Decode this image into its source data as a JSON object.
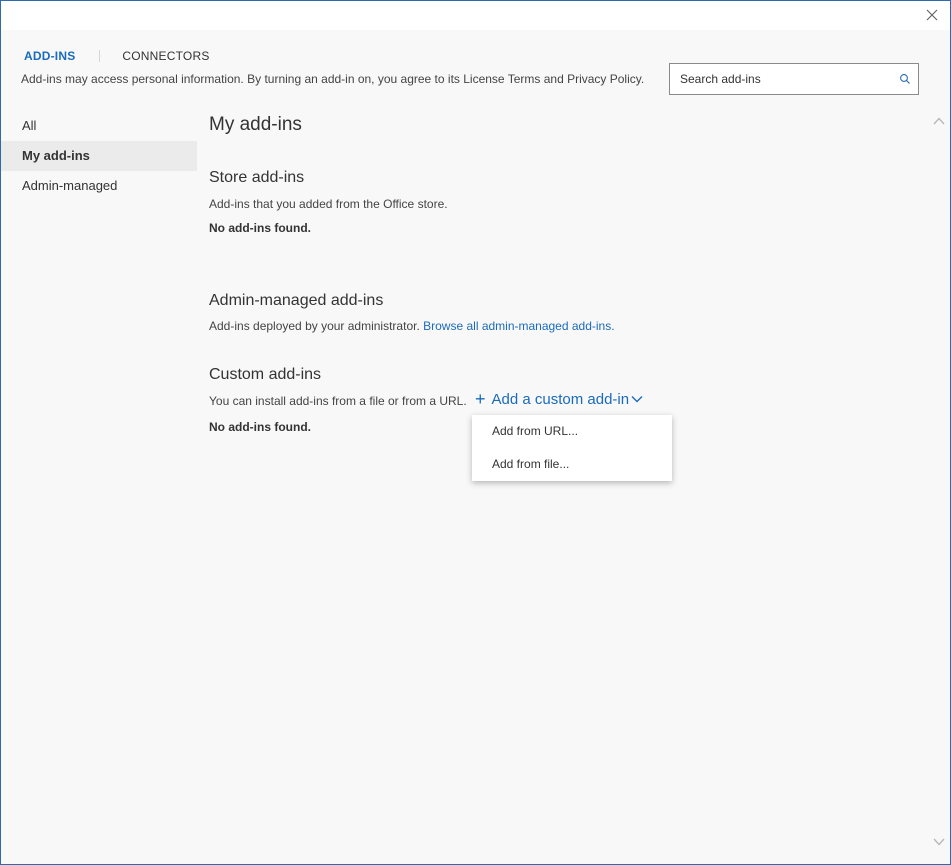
{
  "window": {
    "close_icon": "close-icon"
  },
  "tabs": [
    {
      "label": "ADD-INS",
      "active": true
    },
    {
      "label": "CONNECTORS",
      "active": false
    }
  ],
  "notice": "Add-ins may access personal information. By turning an add-in on, you agree to its License Terms and Privacy Policy.",
  "search": {
    "placeholder": "Search add-ins",
    "icon": "search-icon"
  },
  "sidebar": {
    "items": [
      {
        "label": "All",
        "selected": false
      },
      {
        "label": "My add-ins",
        "selected": true
      },
      {
        "label": "Admin-managed",
        "selected": false
      }
    ]
  },
  "main": {
    "title": "My add-ins",
    "store": {
      "title": "Store add-ins",
      "description": "Add-ins that you added from the Office store.",
      "empty": "No add-ins found."
    },
    "admin": {
      "title": "Admin-managed add-ins",
      "description": "Add-ins deployed by your administrator.",
      "link": "Browse all admin-managed add-ins."
    },
    "custom": {
      "title": "Custom add-ins",
      "description": "You can install add-ins from a file or from a URL.",
      "add_button": "Add a custom add-in",
      "empty": "No add-ins found."
    }
  },
  "dropdown": {
    "items": [
      {
        "label": "Add from URL..."
      },
      {
        "label": "Add from file..."
      }
    ]
  },
  "colors": {
    "accent": "#1a6bbd",
    "window_border": "#2b6cb0",
    "background": "#f8f8f8",
    "selected_item": "#ebebeb"
  }
}
